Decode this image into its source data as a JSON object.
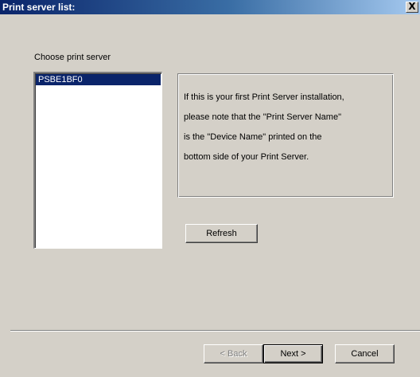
{
  "window": {
    "title": "Print server list:",
    "close_label": "X"
  },
  "choose_label": "Choose print server",
  "servers": [
    {
      "name": "PSBE1BF0",
      "selected": true
    }
  ],
  "info": {
    "line1": "If this is your first Print Server installation,",
    "line2": "please note that the \"Print Server Name\"",
    "line3": "is the \"Device Name\" printed on the",
    "line4": "bottom side of your Print Server."
  },
  "buttons": {
    "refresh": "Refresh",
    "back": "< Back",
    "next": "Next >",
    "cancel": "Cancel"
  },
  "colors": {
    "face": "#d4d0c8",
    "selection": "#0a246a",
    "title_start": "#0a246a",
    "title_end": "#a6caf0"
  }
}
